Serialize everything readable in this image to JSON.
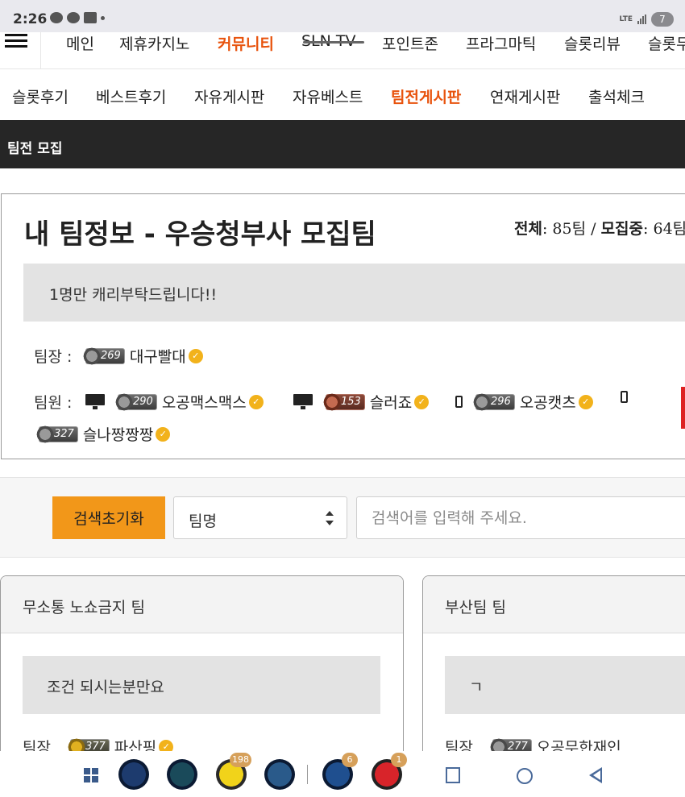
{
  "status": {
    "time": "2:26",
    "network": "LTE",
    "battery": "7"
  },
  "nav_main": {
    "items": [
      "메인",
      "제휴카지노",
      "커뮤니티",
      "SLN TV",
      "포인트존",
      "프라그마틱",
      "슬롯리뷰",
      "슬롯무"
    ],
    "active": "커뮤니티"
  },
  "nav_sub": {
    "items": [
      "슬롯후기",
      "베스트후기",
      "자유게시판",
      "자유베스트",
      "팀전게시판",
      "연재게시판",
      "출석체크"
    ],
    "active": "팀전게시판"
  },
  "section_title": "팀전 모집",
  "my_team": {
    "title": "내 팀정보 - 우승청부사 모집팀",
    "count_total_label": "전체",
    "count_total": "85팀",
    "count_recruiting_label": "모집중",
    "count_recruiting": "64팀",
    "notice": "1명만 캐리부탁드립니다!!",
    "leader_label": "팀장 :",
    "leader": {
      "level": "269",
      "name": "대구빨대"
    },
    "members_label": "팀원 :",
    "members": [
      {
        "device": "pc",
        "level": "290",
        "name": "오공맥스맥스"
      },
      {
        "device": "pc",
        "level": "153",
        "name": "슬러죠"
      },
      {
        "device": "mobile",
        "level": "296",
        "name": "오공캣츠"
      },
      {
        "device": "mobile",
        "level": "327",
        "name": "슬나짱짱짱"
      }
    ]
  },
  "search": {
    "reset_label": "검색초기화",
    "select_value": "팀명",
    "placeholder": "검색어를 입력해 주세요."
  },
  "cards": [
    {
      "name": "무소통 노쇼금지 팀",
      "notice": "조건 되시는분만요",
      "leader_label": "팀장",
      "leader_level": "377",
      "leader_name": "파산핑"
    },
    {
      "name": "부산팀 팀",
      "notice": "ㄱ",
      "leader_label": "팀장",
      "leader_level": "277",
      "leader_name": "오공무한재인"
    }
  ],
  "dock": {
    "badges": [
      "198",
      "6",
      "1"
    ],
    "icons": [
      "app-grid-icon",
      "phone-icon",
      "chat-icon",
      "kakaotalk-icon",
      "globe-icon",
      "live-score-icon",
      "record-icon"
    ]
  },
  "colors": {
    "accent": "#e8530d",
    "button": "#f29719",
    "section_bar": "#262626",
    "verified": "#f2b21b"
  }
}
